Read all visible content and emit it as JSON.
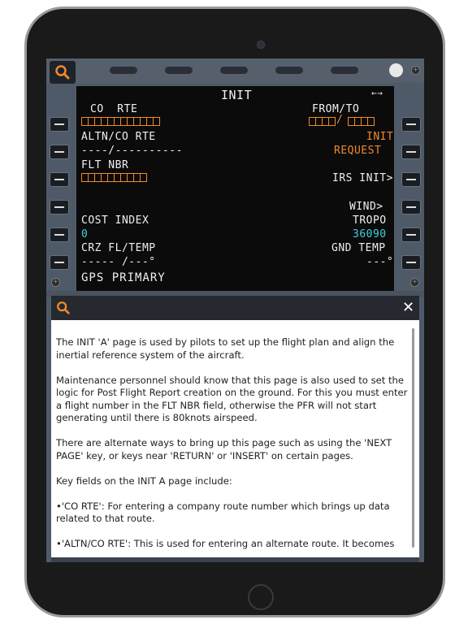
{
  "cdu": {
    "title": "INIT",
    "arrows": "←→",
    "l1_label": "CO  RTE",
    "r1_label": "FROM/TO",
    "r1_sep": "/",
    "l2_label": "ALTN/CO RTE",
    "l2_value": "----/----------",
    "r2_line1": "INIT",
    "r2_line2": "REQUEST",
    "l3_label": "FLT NBR",
    "r3_value": "IRS INIT>",
    "r4_value": "WIND>",
    "l5_label": "COST INDEX",
    "l5_value": "0",
    "r5_label": "TROPO",
    "r5_value": "36090",
    "l6_label": "CRZ FL/TEMP",
    "l6_value": "----- /---°",
    "r6_label": "GND TEMP",
    "r6_value": "---°",
    "scratchpad": "GPS PRIMARY"
  },
  "help": {
    "close_label": "✕",
    "paragraphs": [
      "The INIT 'A' page is used by pilots to set up the flight plan and align the inertial reference system of the aircraft.",
      "Maintenance personnel should know that this page is also used to set the logic for Post Flight Report creation on the ground. For this you must enter a flight number in the FLT NBR field, otherwise the PFR will not start generating until there is 80knots airspeed.",
      "There are alternate ways to bring up this page such as using the 'NEXT PAGE' key, or keys near 'RETURN' or 'INSERT' on certain pages.",
      "Key fields on the INIT A page include:",
      "•'CO RTE': For entering a company route number which brings up data related to that route.",
      "•'ALTN/CO RTE': This is used for entering an alternate route. It becomes"
    ]
  },
  "icons": {
    "search": "search-icon",
    "close": "close-icon"
  },
  "colors": {
    "amber": "#f08a2a",
    "cyan": "#3fd2e0",
    "white": "#f0f0f0",
    "panel": "#4f5a68"
  }
}
